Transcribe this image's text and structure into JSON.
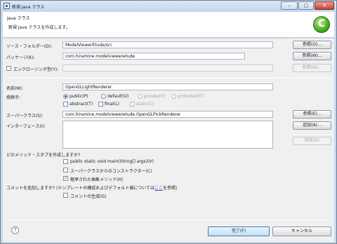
{
  "window": {
    "title": "新規 Java クラス",
    "icon": "java-class-icon",
    "buttons": [
      "minimize-icon",
      "maximize-icon",
      "close-icon"
    ]
  },
  "banner": {
    "title": "Java クラス",
    "message": "新規 Java クラスを作成します。",
    "icon": "new-class-wizard-icon"
  },
  "source_folder": {
    "label": "ソース・フォルダー(D):",
    "value": "ModelViewerEtude/src",
    "browse": "参照(O)..."
  },
  "package": {
    "label": "パッケージ(K):",
    "value": "com.hiramine.modelvieweretude",
    "browse": "参照(W)..."
  },
  "enclosing_type": {
    "label": "エンクロージング型(Y):",
    "value": "",
    "browse": "参照(W)..."
  },
  "name": {
    "label": "名前(M):",
    "value": "OpenGLLightRenderer"
  },
  "modifiers": {
    "label": "修飾子:",
    "visibility": [
      {
        "label": "public(P)",
        "selected": true,
        "enabled": true
      },
      {
        "label": "default(U)",
        "selected": false,
        "enabled": true
      },
      {
        "label": "private(V)",
        "selected": false,
        "enabled": false
      },
      {
        "label": "protected(T)",
        "selected": false,
        "enabled": false
      }
    ],
    "flags": [
      {
        "label": "abstract(T)",
        "checked": false,
        "enabled": true
      },
      {
        "label": "final(L)",
        "checked": false,
        "enabled": true
      },
      {
        "label": "static(C)",
        "checked": false,
        "enabled": false
      }
    ]
  },
  "superclass": {
    "label": "スーパークラス(S):",
    "value": "com.hiramine.modelvieweretude.OpenGLPickRenderer",
    "browse": "参照(E)..."
  },
  "interfaces": {
    "label": "インターフェース(I):",
    "add": "追加(A)...",
    "remove": "除去(R)"
  },
  "stubs": {
    "question": "どのメソッド・スタブを作成しますか?",
    "options": [
      {
        "label": "public static void main(String[] args)(V)",
        "checked": false
      },
      {
        "label": "スーパークラスからのコンストラクター(C)",
        "checked": false
      },
      {
        "label": "継承された抽象メソッド(H)",
        "checked": true
      }
    ]
  },
  "comments": {
    "question_prefix": "コメントを追加しますか? (テンプレートの構成およびデフォルト値については",
    "link": "ここ",
    "question_suffix": "を参照)",
    "option": {
      "label": "コメントの生成(G)",
      "checked": false
    }
  },
  "footer": {
    "help_icon": "help-icon",
    "finish": "完了(F)",
    "cancel": "キャンセル"
  }
}
